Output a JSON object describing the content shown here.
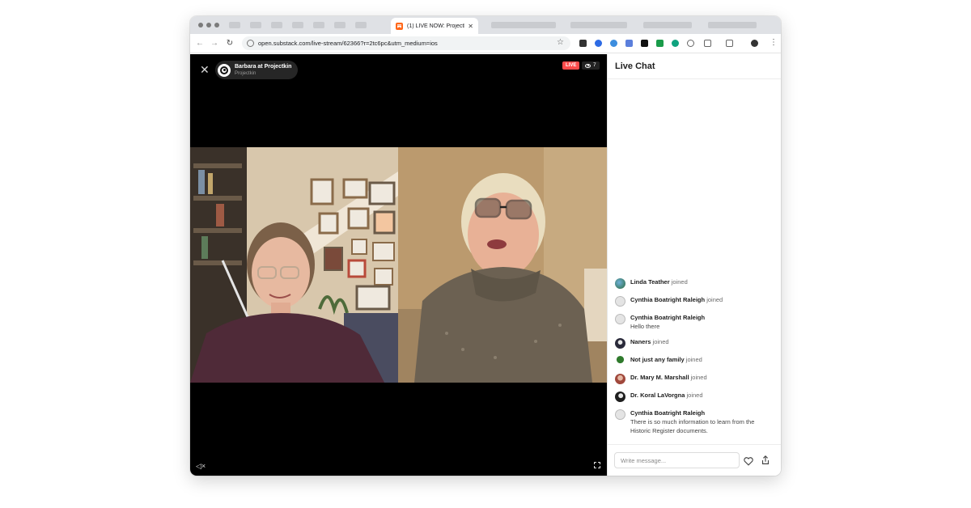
{
  "browser": {
    "tab_title": "(1) LIVE NOW: Projectki",
    "tab_close": "✕",
    "url": "open.substack.com/live-stream/62366?r=2tc6pc&utm_medium=ios",
    "back_glyph": "←",
    "forward_glyph": "→",
    "reload_glyph": "↻",
    "star_glyph": "☆",
    "menu_glyph": "⋮"
  },
  "stream": {
    "host_name": "Barbara at Projectkin",
    "publication": "Projectkin",
    "live_label": "LIVE",
    "viewer_count": "7",
    "close_glyph": "✕",
    "mute_glyph": "◁×"
  },
  "chat": {
    "title": "Live Chat",
    "composer_placeholder": "Write message...",
    "messages": [
      {
        "name": "Linda Teather",
        "action": "joined",
        "text": ""
      },
      {
        "name": "Cynthia Boatright Raleigh",
        "action": "joined",
        "text": ""
      },
      {
        "name": "Cynthia Boatright Raleigh",
        "action": "",
        "text": "Hello there"
      },
      {
        "name": "Naners",
        "action": "joined",
        "text": ""
      },
      {
        "name": "Not just any family",
        "action": "joined",
        "text": ""
      },
      {
        "name": "Dr. Mary M. Marshall",
        "action": "joined",
        "text": ""
      },
      {
        "name": "Dr. Koral LaVorgna",
        "action": "joined",
        "text": ""
      },
      {
        "name": "Cynthia Boatright Raleigh",
        "action": "",
        "text": "There is so much information to learn from the Historic Register documents."
      }
    ]
  },
  "colors": {
    "live_red": "#ff4b4b",
    "substack_orange": "#ff6719"
  }
}
